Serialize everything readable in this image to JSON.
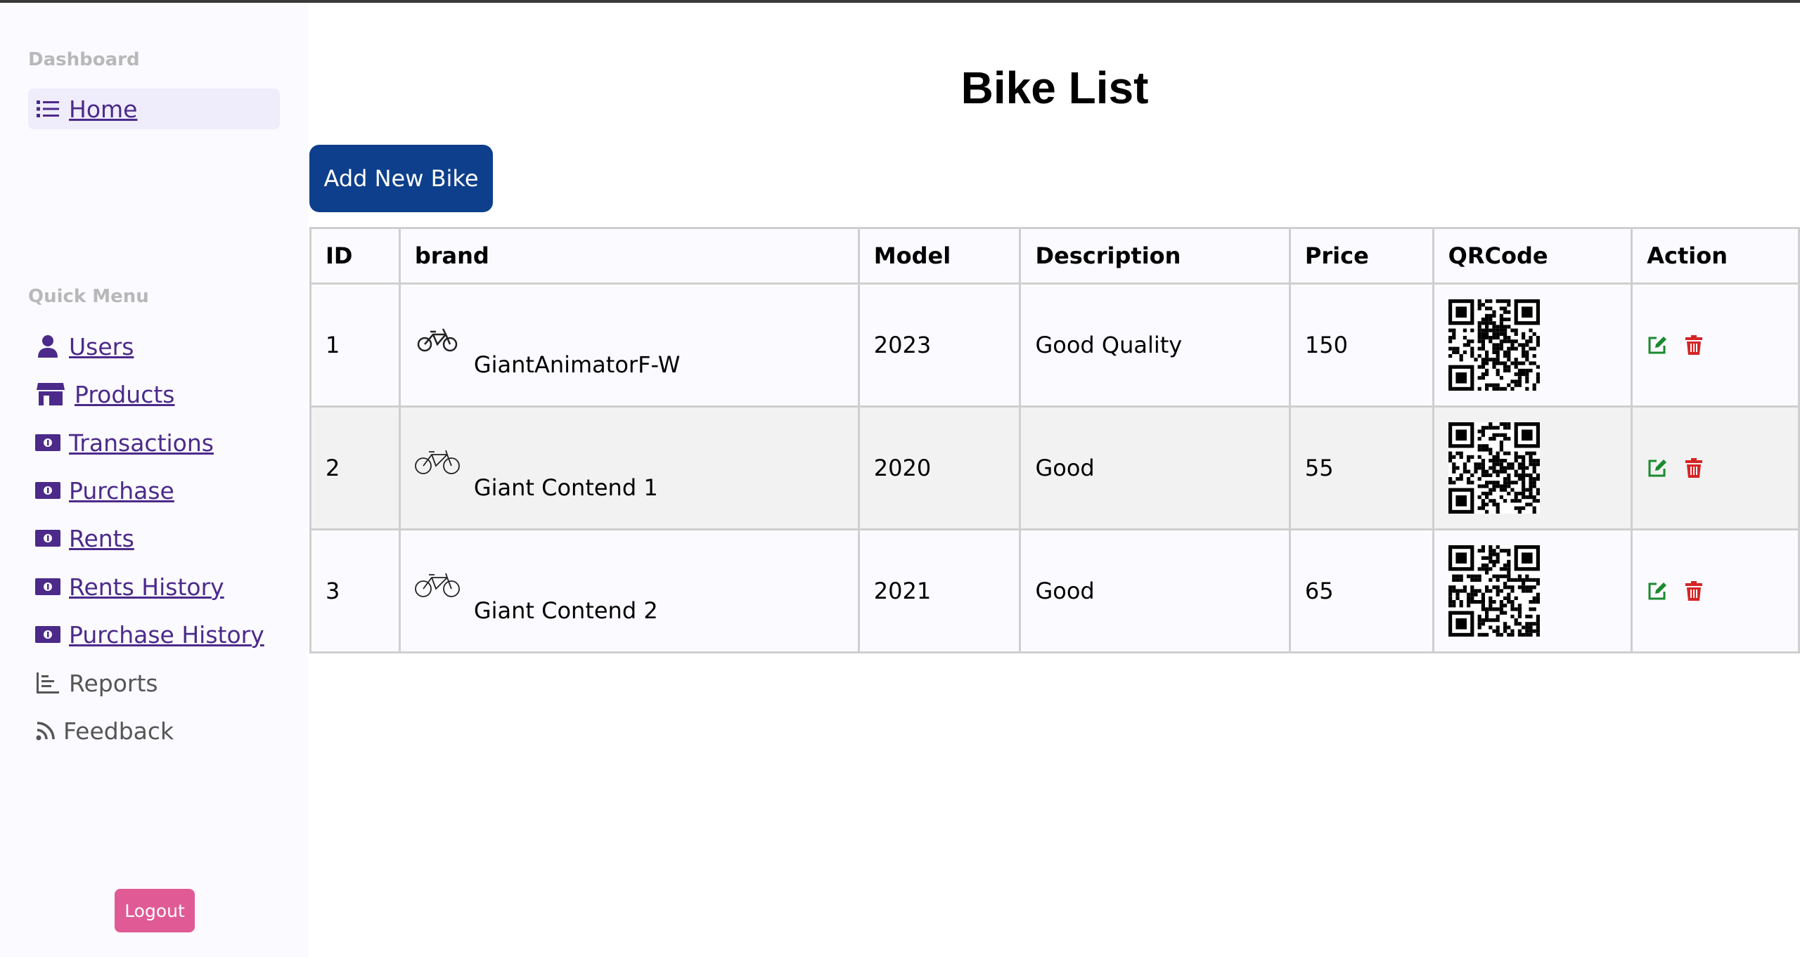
{
  "sidebar": {
    "dashboard_title": "Dashboard",
    "home_label": "Home",
    "quick_menu_title": "Quick Menu",
    "items": [
      {
        "label": "Users",
        "icon": "user-icon"
      },
      {
        "label": "Products",
        "icon": "store-icon"
      },
      {
        "label": "Transactions",
        "icon": "money-icon"
      },
      {
        "label": "Purchase",
        "icon": "money-icon"
      },
      {
        "label": "Rents",
        "icon": "money-icon"
      },
      {
        "label": "Rents History",
        "icon": "money-icon"
      },
      {
        "label": "Purchase History",
        "icon": "money-icon"
      },
      {
        "label": "Reports",
        "icon": "chart-icon"
      },
      {
        "label": "Feedback",
        "icon": "rss-icon"
      }
    ],
    "logout_label": "Logout"
  },
  "main": {
    "title": "Bike List",
    "add_button_label": "Add New Bike",
    "table": {
      "headers": [
        "ID",
        "brand",
        "Model",
        "Description",
        "Price",
        "QRCode",
        "Action"
      ],
      "rows": [
        {
          "id": "1",
          "brand": "GiantAnimatorF-W",
          "model": "2023",
          "description": "Good Quality",
          "price": "150"
        },
        {
          "id": "2",
          "brand": "Giant Contend 1",
          "model": "2020",
          "description": "Good",
          "price": "55"
        },
        {
          "id": "3",
          "brand": "Giant Contend 2",
          "model": "2021",
          "description": "Good",
          "price": "65"
        }
      ]
    }
  },
  "colors": {
    "nav_link": "#4b2a8a",
    "add_button": "#0d3f8c",
    "logout_button": "#e05a95",
    "edit_icon": "#1a8a2e",
    "delete_icon": "#d62424"
  }
}
